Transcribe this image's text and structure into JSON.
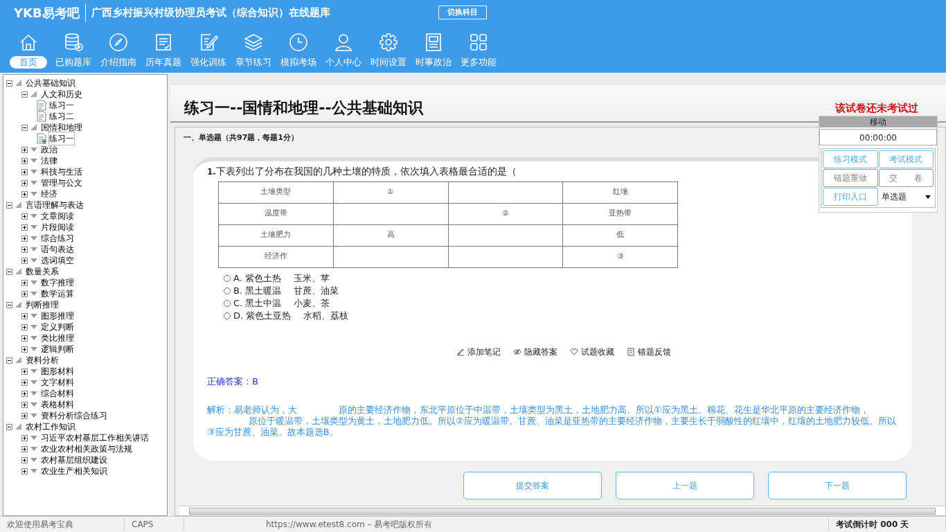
{
  "header": {
    "logo": "YKB易考吧",
    "title": "广西乡村振兴村级协理员考试（综合知识）在线题库",
    "switch_button": "切换科目"
  },
  "nav": [
    {
      "label": "首页",
      "selected": true
    },
    {
      "label": "已购题库",
      "selected": false
    },
    {
      "label": "介绍指南",
      "selected": false
    },
    {
      "label": "历年真题",
      "selected": false
    },
    {
      "label": "强化训练",
      "selected": false
    },
    {
      "label": "章节练习",
      "selected": false
    },
    {
      "label": "模拟考场",
      "selected": false
    },
    {
      "label": "个人中心",
      "selected": false
    },
    {
      "label": "时间设置",
      "selected": false
    },
    {
      "label": "时事政治",
      "selected": false
    },
    {
      "label": "更多功能",
      "selected": false
    }
  ],
  "tree": [
    {
      "label": "公共基础知识",
      "expanded": true,
      "children": [
        {
          "label": "人文和历史",
          "expanded": true,
          "children": [
            {
              "label": "练习一",
              "selected": false
            },
            {
              "label": "练习二",
              "selected": false
            }
          ]
        },
        {
          "label": "国情和地理",
          "expanded": true,
          "children": [
            {
              "label": "练习一",
              "selected": true
            }
          ]
        },
        {
          "label": "政治",
          "expanded": false
        },
        {
          "label": "法律",
          "expanded": false
        },
        {
          "label": "科技与生活",
          "expanded": false
        },
        {
          "label": "管理与公文",
          "expanded": false
        },
        {
          "label": "经济",
          "expanded": false
        }
      ]
    },
    {
      "label": "言语理解与表达",
      "expanded": true,
      "children": [
        {
          "label": "文章阅读",
          "expanded": false
        },
        {
          "label": "片段阅读",
          "expanded": false
        },
        {
          "label": "综合练习",
          "expanded": false
        },
        {
          "label": "语句表达",
          "expanded": false
        },
        {
          "label": "选词填空",
          "expanded": false
        }
      ]
    },
    {
      "label": "数量关系",
      "expanded": true,
      "children": [
        {
          "label": "数字推理",
          "expanded": false
        },
        {
          "label": "数学运算",
          "expanded": false
        }
      ]
    },
    {
      "label": "判断推理",
      "expanded": true,
      "children": [
        {
          "label": "图形推理",
          "expanded": false
        },
        {
          "label": "定义判断",
          "expanded": false
        },
        {
          "label": "类比推理",
          "expanded": false
        },
        {
          "label": "逻辑判断",
          "expanded": false
        }
      ]
    },
    {
      "label": "资料分析",
      "expanded": true,
      "children": [
        {
          "label": "图形材料",
          "expanded": false
        },
        {
          "label": "文字材料",
          "expanded": false
        },
        {
          "label": "综合材料",
          "expanded": false
        },
        {
          "label": "表格材料",
          "expanded": false
        },
        {
          "label": "资料分析综合练习",
          "expanded": false
        }
      ]
    },
    {
      "label": "农村工作知识",
      "expanded": true,
      "children": [
        {
          "label": "习近平农村基层工作相关讲话",
          "expanded": false
        },
        {
          "label": "农业农村相关政策与法规",
          "expanded": false
        },
        {
          "label": "农村基层组织建设",
          "expanded": false
        },
        {
          "label": "农业生产相关知识",
          "expanded": false
        }
      ]
    }
  ],
  "paper": {
    "title": "练习一--国情和地理--公共基础知识",
    "status": "该试卷还未考试过",
    "section": "一、单选题（共97题，每题1分）"
  },
  "question": {
    "number": "1.",
    "text": "下表列出了分布在我国的几种土壤的特质，依次填入表格最合适的是（",
    "table": [
      {
        "column_1": "土壤类型",
        "column_2": "①",
        "column_4": "红壤"
      },
      {
        "column_1": "温度带",
        "column_3": "②",
        "column_4": "亚热带"
      },
      {
        "column_1": "土壤肥力",
        "column_2": "高",
        "column_4": "低"
      },
      {
        "column_1": "经济作",
        "column_4": "③"
      }
    ],
    "options": [
      {
        "parts": [
          "A. 紫色土热",
          "玉米、苹"
        ],
        "checked": false
      },
      {
        "parts": [
          "B. 黑土暖温",
          "甘蔗、油菜"
        ],
        "checked": false
      },
      {
        "parts": [
          "C. 黑土中温",
          "小麦、茶"
        ],
        "checked": false
      },
      {
        "parts": [
          "D. 紫色土亚热",
          "水稻、荔枝"
        ],
        "checked": false
      }
    ],
    "tools": [
      "添加笔记",
      "隐藏答案",
      "试题收藏",
      "错题反馈"
    ],
    "answer": "正确答案：B",
    "explanation": [
      "解析：易老师认为，大",
      "原的主要经济作物，东北平原位于中温带，土壤类型为黑土，土地肥力高。所以①应为黑土。棉花、花生是华北平原的主要经济作物，",
      "原位于暖温带，土壤类型为黄土，土地肥力低。所以②应为暖温带。甘蔗、油菜是亚热带的主要经济作物，主要生长于弱酸性的红壤中，红壤的土地肥力较低。所以③应为甘蔗、油菜。故本题选B。"
    ]
  },
  "bottom_buttons": [
    "提交答案",
    "上一题",
    "下一题"
  ],
  "panel": {
    "header": "移动",
    "timer": "00:00:00",
    "buttons": [
      {
        "label": "练习模式",
        "disabled": false
      },
      {
        "label": "考试模式",
        "disabled": false
      },
      {
        "label": "错题重做",
        "disabled": true
      },
      {
        "label": "交　　卷",
        "disabled": true
      },
      {
        "label": "打印入口",
        "disabled": false
      }
    ],
    "type_select": "单选题"
  },
  "status_bar": {
    "welcome": "欢迎使用易考宝典",
    "caps": "CAPS",
    "copyright": "https://www.etest8.com – 易考吧版权所有",
    "countdown": "考试倒计时 000 天"
  }
}
